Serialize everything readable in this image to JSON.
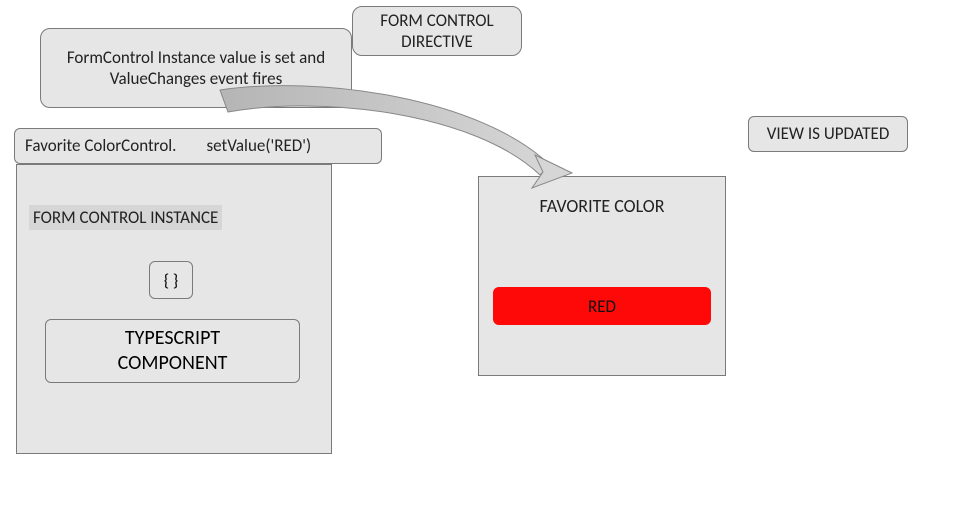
{
  "topBox": {
    "text": "FormControl Instance value is set and ValueChanges event fires"
  },
  "directiveBox": {
    "text": "FORM CONTROL DIRECTIVE"
  },
  "setValueBox": {
    "left": "Favorite ColorControl.",
    "right": "setValue('RED')"
  },
  "viewUpdated": {
    "text": "VIEW IS UPDATED"
  },
  "leftPanel": {
    "instanceLabel": "FORM CONTROL INSTANCE",
    "curly": "{ }",
    "typescriptLine1": "TYPESCRIPT",
    "typescriptLine2": "COMPONENT"
  },
  "rightPanel": {
    "title": "FAVORITE COLOR",
    "value": "RED"
  }
}
